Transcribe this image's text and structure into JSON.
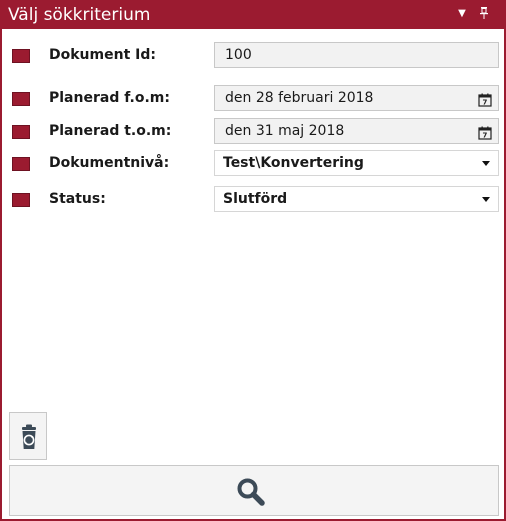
{
  "window": {
    "title": "Välj sökkriterium"
  },
  "icons": {
    "dropdown": "chevron-down-icon",
    "pin": "pin-icon",
    "calendar": "calendar-icon",
    "recycle": "recycle-bin-icon",
    "search": "search-icon"
  },
  "colors": {
    "accent": "#9b1b30",
    "field_bg": "#f2f2f2"
  },
  "criteria": [
    {
      "label": "Dokument Id:",
      "value": "100",
      "kind": "text"
    },
    {
      "label": "Planerad f.o.m:",
      "value": "den 28 februari 2018",
      "kind": "date"
    },
    {
      "label": "Planerad t.o.m:",
      "value": "den 31 maj 2018",
      "kind": "date"
    },
    {
      "label": "Dokumentnivå:",
      "value": "Test\\Konvertering",
      "kind": "dropdown"
    },
    {
      "label": "Status:",
      "value": "Slutförd",
      "kind": "dropdown"
    }
  ]
}
